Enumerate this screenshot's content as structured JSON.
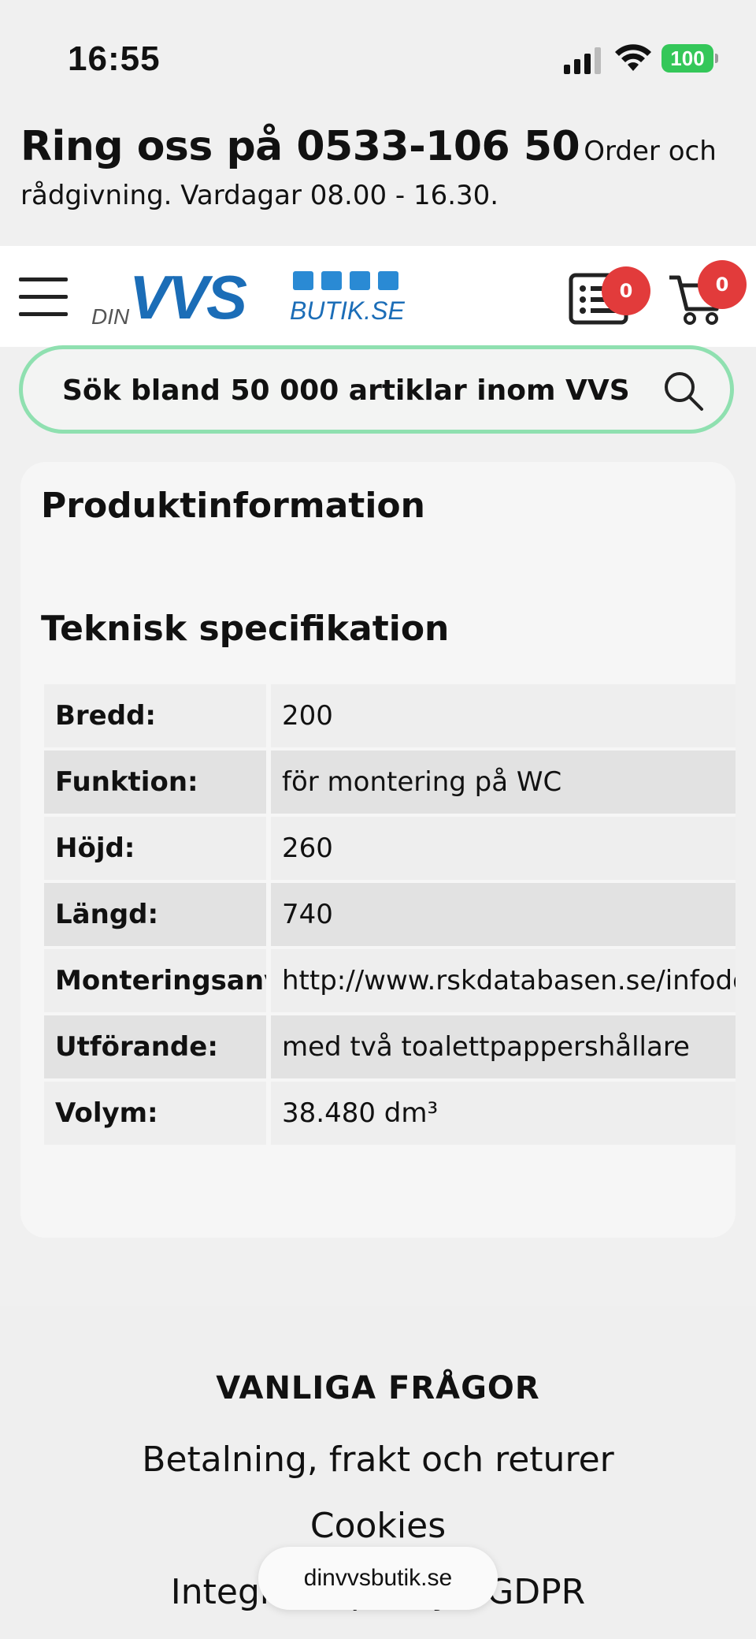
{
  "status_bar": {
    "time": "16:55",
    "battery": "100",
    "battery_color": "#34c759",
    "icons": [
      "signal-icon",
      "wifi-icon",
      "battery-icon"
    ]
  },
  "phone_bar": {
    "big": "Ring oss på 0533-106 50",
    "small": "Order och",
    "line2": "rådgivning. Vardagar 08.00 - 16.30."
  },
  "header": {
    "logo": {
      "din": "DIN",
      "vvs": "VVS",
      "butik": "BUTIK.SE"
    },
    "quotes_count": "0",
    "cart_count": "0",
    "brand_color": "#1b6db7",
    "badge_color": "#e23b3b"
  },
  "search": {
    "placeholder": "Sök bland 50 000 artiklar inom VVS",
    "border_color": "#8fe0b0"
  },
  "product": {
    "info_title": "Produktinformation",
    "spec_title": "Teknisk specifikation",
    "specs": [
      {
        "key": "Bredd:",
        "value": "200"
      },
      {
        "key": "Funktion:",
        "value": "för montering på WC"
      },
      {
        "key": "Höjd:",
        "value": "260"
      },
      {
        "key": "Längd:",
        "value": "740"
      },
      {
        "key": "Monteringsanv:",
        "value": "http://www.rskdatabasen.se/infodoc"
      },
      {
        "key": "Utförande:",
        "value": "med två toalettpappershållare"
      },
      {
        "key": "Volym:",
        "value": "38.480 dm³"
      }
    ]
  },
  "footer": {
    "heading": "VANLIGA FRÅGOR",
    "links": [
      "Betalning, frakt och returer",
      "Cookies",
      "Integritetspolicy - GDPR"
    ]
  },
  "browser": {
    "url": "dinvvsbutik.se"
  }
}
